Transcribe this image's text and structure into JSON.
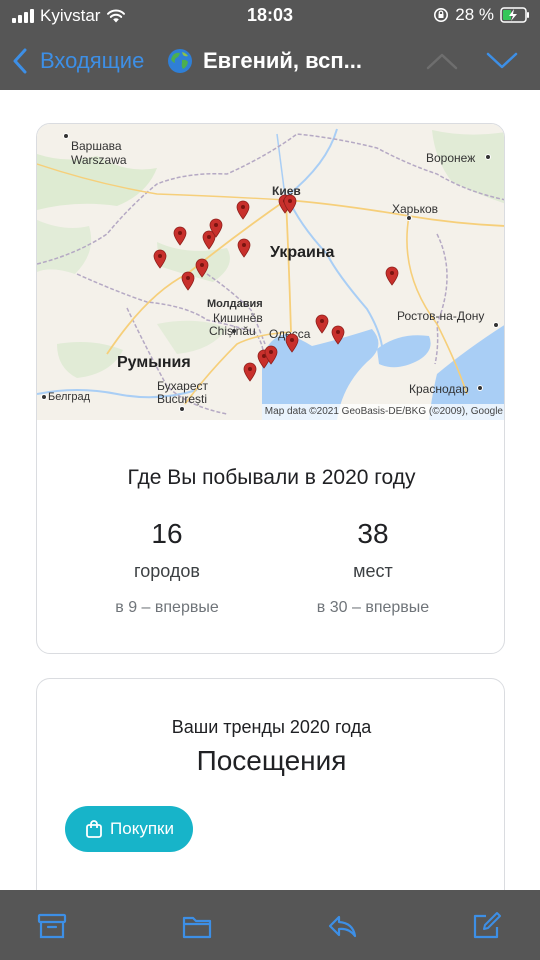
{
  "status_bar": {
    "carrier": "Kyivstar",
    "time": "18:03",
    "battery_percent": "28 %"
  },
  "nav": {
    "back_label": "Входящие",
    "title": "Евгений, всп..."
  },
  "places_card": {
    "map_labels": {
      "warsaw": "Варшава",
      "warsaw_native": "Warszawa",
      "voronezh": "Воронеж",
      "kyiv": "Киев",
      "kharkiv": "Харьков",
      "ukraine": "Украина",
      "moldova": "Молдавия",
      "chisinau": "Кишинёв",
      "chisinau_native": "Chișinău",
      "odessa": "Одесса",
      "rostov": "Ростов-на-Дону",
      "romania": "Румыния",
      "bucharest": "Бухарест",
      "bucharest_native": "București",
      "belgrade": "Белград",
      "krasnodar": "Краснодар"
    },
    "attribution": "Map data ©2021 GeoBasis-DE/BKG (©2009), Google",
    "title": "Где Вы побывали в 2020 году",
    "cities": {
      "count": "16",
      "unit": "городов",
      "note": "в 9 – впервые"
    },
    "places": {
      "count": "38",
      "unit": "мест",
      "note": "в 30 – впервые"
    }
  },
  "trends_card": {
    "subtitle": "Ваши тренды 2020 года",
    "title": "Посещения",
    "chip_label": "Покупки"
  },
  "colors": {
    "bar_background": "#565656",
    "link_blue": "#3d8fe6",
    "pin_red": "#c8302c",
    "chip_teal": "#17b4c9"
  },
  "icons": [
    "signal-icon",
    "wifi-icon",
    "rotation-lock-icon",
    "battery-charging-icon",
    "back-chevron-icon",
    "globe-icon",
    "chevron-up-icon",
    "chevron-down-icon",
    "map-pin-icon",
    "shopping-bag-icon",
    "archive-icon",
    "folder-icon",
    "reply-icon",
    "compose-icon"
  ]
}
